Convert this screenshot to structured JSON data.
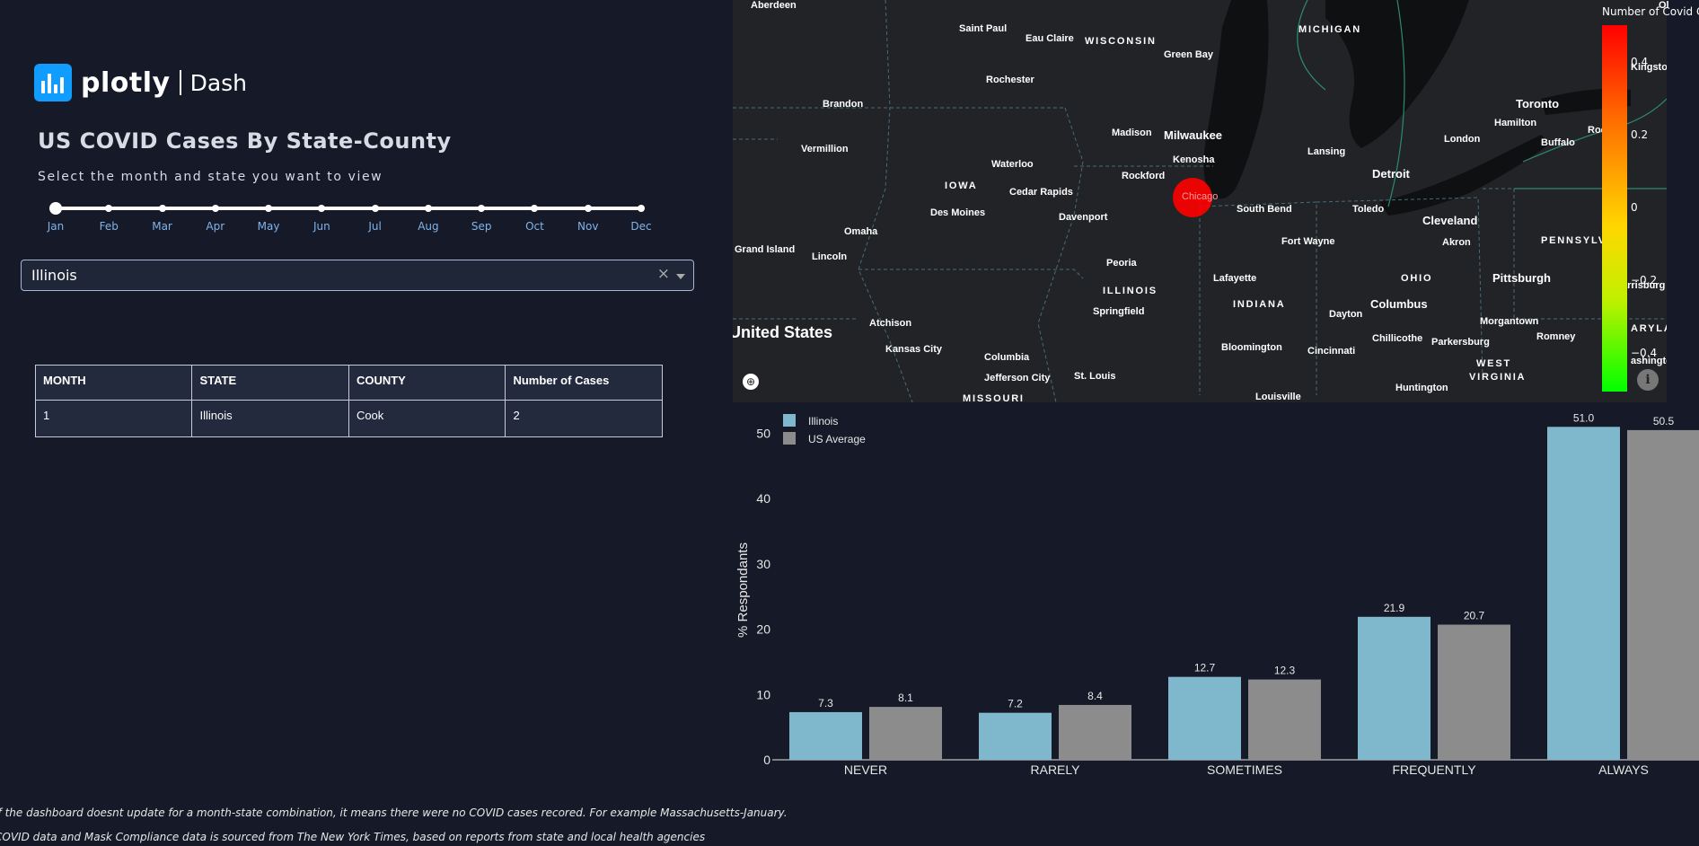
{
  "app": {
    "logo_text": "plotly",
    "logo_product": "Dash"
  },
  "header": {
    "title": "US COVID Cases By State-County",
    "subtitle": "Select the month and state you want to view"
  },
  "month_slider": {
    "labels": [
      "Jan",
      "Feb",
      "Mar",
      "Apr",
      "May",
      "Jun",
      "Jul",
      "Aug",
      "Sep",
      "Oct",
      "Nov",
      "Dec"
    ],
    "selected_index": 0
  },
  "state_dropdown": {
    "value": "Illinois",
    "clear_glyph": "×"
  },
  "cases_table": {
    "headers": [
      "MONTH",
      "STATE",
      "COUNTY",
      "Number of Cases"
    ],
    "rows": [
      [
        "1",
        "Illinois",
        "Cook",
        "2"
      ]
    ]
  },
  "footnotes": [
    "If the dashboard doesnt update for a month-state combination, it means there were no COVID cases recored. For example Massachusetts-January.",
    "COVID data and Mask Compliance data is sourced from The New York Times, based on reports from state and local health agencies"
  ],
  "map": {
    "colorbar_title": "Number of Covid Cases",
    "colorbar_ticks": [
      "0.4",
      "0.2",
      "0",
      "−0.2",
      "−0.4"
    ],
    "highlight_city": "Chicago",
    "highlight_color": "#ff0000",
    "country_label": "United States",
    "state_labels": [
      "WISCONSIN",
      "MICHIGAN",
      "IOWA",
      "ILLINOIS",
      "INDIANA",
      "OHIO",
      "PENNSYLV",
      "WEST",
      "VIRGINIA",
      "MISSOURI",
      "ARYLAN"
    ],
    "city_labels": [
      "Aberdeen",
      "Saint Paul",
      "Eau Claire",
      "Green Bay",
      "Rochester",
      "Brandon",
      "Vermillion",
      "Madison",
      "Milwaukee",
      "Kenosha",
      "Waterloo",
      "Rockford",
      "Cedar Rapids",
      "Des Moines",
      "Davenport",
      "Omaha",
      "Lincoln",
      "Grand Island",
      "Peoria",
      "Springfield",
      "Atchison",
      "Kansas City",
      "Columbia",
      "Jefferson City",
      "St. Louis",
      "South Bend",
      "Fort Wayne",
      "Lafayette",
      "Bloomington",
      "Louisville",
      "Lansing",
      "Detroit",
      "Toledo",
      "Cleveland",
      "Akron",
      "Dayton",
      "Columbus",
      "Cincinnati",
      "Chillicothe",
      "Parkersburg",
      "Huntington",
      "Pittsburgh",
      "Morgantown",
      "Romney",
      "London",
      "Hamilton",
      "Toronto",
      "Buffalo",
      "Kingston",
      "Roc",
      "arrisburg",
      "ashingto"
    ],
    "corner_label": "Ol",
    "info_glyph": "i",
    "geo_glyph": "⊕"
  },
  "chart_data": {
    "type": "bar",
    "categories": [
      "NEVER",
      "RARELY",
      "SOMETIMES",
      "FREQUENTLY",
      "ALWAYS"
    ],
    "series": [
      {
        "name": "Illinois",
        "color": "#7fb8cd",
        "values": [
          7.3,
          7.2,
          12.7,
          21.9,
          51.0
        ],
        "labels": [
          "7.3",
          "7.2",
          "12.7",
          "21.9",
          "51.0"
        ]
      },
      {
        "name": "US Average",
        "color": "#8c8c8c",
        "values": [
          8.1,
          8.4,
          12.3,
          20.7,
          50.5
        ],
        "labels": [
          "8.1",
          "8.4",
          "12.3",
          "20.7",
          "50.5"
        ]
      }
    ],
    "ylabel": "% Respondants",
    "yticks": [
      0,
      10,
      20,
      30,
      40,
      50
    ],
    "ytick_labels": [
      "0",
      "10",
      "20",
      "30",
      "40",
      "50"
    ],
    "ylim": [
      0,
      52
    ],
    "legend_position": "top-left",
    "grid": false
  }
}
